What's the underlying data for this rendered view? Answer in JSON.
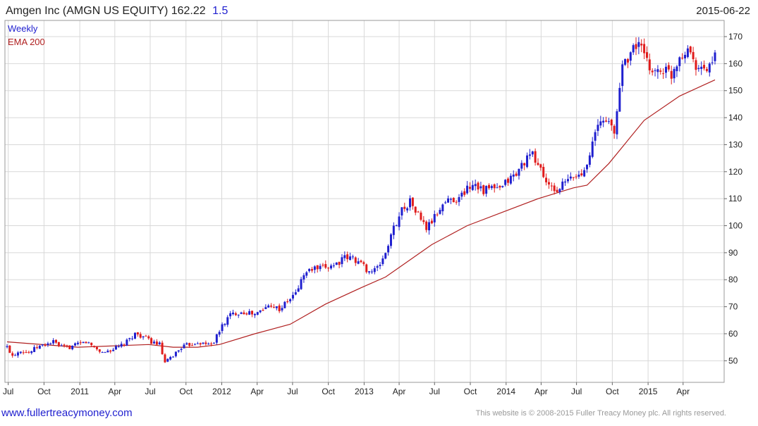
{
  "header": {
    "title": "Amgen Inc (AMGN US EQUITY) 162.22",
    "change": "1.5",
    "date": "2015-06-22"
  },
  "legend": {
    "period": "Weekly",
    "ema_label": "EMA 200"
  },
  "footer": {
    "link": "www.fullertreacymoney.com",
    "copyright": "This website is © 2008-2015 Fuller Treacy Money plc. All rights reserved."
  },
  "colors": {
    "up": "#1f1fcf",
    "down": "#e01b1b",
    "ema": "#b02020",
    "grid": "#d8d8d8",
    "title_change": "#1f1fcf"
  },
  "chart_data": {
    "type": "candlestick",
    "frequency": "weekly",
    "x_range": [
      "2010-06-28",
      "2015-06-22"
    ],
    "ylim": [
      42,
      176
    ],
    "y_ticks": [
      50,
      60,
      70,
      80,
      90,
      100,
      110,
      120,
      130,
      140,
      150,
      160,
      170
    ],
    "x_tick_labels": [
      {
        "date": "2010-07-01",
        "label": "Jul"
      },
      {
        "date": "2010-10-01",
        "label": "Oct"
      },
      {
        "date": "2011-01-01",
        "label": "2011"
      },
      {
        "date": "2011-04-01",
        "label": "Apr"
      },
      {
        "date": "2011-07-01",
        "label": "Jul"
      },
      {
        "date": "2011-10-01",
        "label": "Oct"
      },
      {
        "date": "2012-01-01",
        "label": "2012"
      },
      {
        "date": "2012-04-01",
        "label": "Apr"
      },
      {
        "date": "2012-07-01",
        "label": "Jul"
      },
      {
        "date": "2012-10-01",
        "label": "Oct"
      },
      {
        "date": "2013-01-01",
        "label": "2013"
      },
      {
        "date": "2013-04-01",
        "label": "Apr"
      },
      {
        "date": "2013-07-01",
        "label": "Jul"
      },
      {
        "date": "2013-10-01",
        "label": "Oct"
      },
      {
        "date": "2014-01-01",
        "label": "2014"
      },
      {
        "date": "2014-04-01",
        "label": "Apr"
      },
      {
        "date": "2014-07-01",
        "label": "Jul"
      },
      {
        "date": "2014-10-01",
        "label": "Oct"
      },
      {
        "date": "2015-01-01",
        "label": "2015"
      },
      {
        "date": "2015-04-01",
        "label": "Apr"
      }
    ],
    "close_path": [
      [
        "2010-06-28",
        55
      ],
      [
        "2010-07-12",
        52
      ],
      [
        "2010-08-02",
        54
      ],
      [
        "2010-08-23",
        53
      ],
      [
        "2010-09-13",
        55
      ],
      [
        "2010-10-04",
        56
      ],
      [
        "2010-10-25",
        57
      ],
      [
        "2010-11-15",
        55
      ],
      [
        "2010-12-06",
        55
      ],
      [
        "2010-12-27",
        56
      ],
      [
        "2011-01-17",
        57
      ],
      [
        "2011-02-07",
        55
      ],
      [
        "2011-02-28",
        53
      ],
      [
        "2011-03-21",
        54
      ],
      [
        "2011-04-11",
        55
      ],
      [
        "2011-05-02",
        57
      ],
      [
        "2011-05-23",
        60
      ],
      [
        "2011-06-13",
        59
      ],
      [
        "2011-07-04",
        57
      ],
      [
        "2011-07-25",
        56
      ],
      [
        "2011-08-08",
        49
      ],
      [
        "2011-08-29",
        52
      ],
      [
        "2011-09-19",
        55
      ],
      [
        "2011-10-10",
        56
      ],
      [
        "2011-10-31",
        57
      ],
      [
        "2011-11-21",
        56
      ],
      [
        "2011-12-12",
        57
      ],
      [
        "2012-01-02",
        63
      ],
      [
        "2012-01-23",
        67
      ],
      [
        "2012-02-13",
        68
      ],
      [
        "2012-03-05",
        68
      ],
      [
        "2012-03-26",
        67
      ],
      [
        "2012-04-16",
        69
      ],
      [
        "2012-05-07",
        71
      ],
      [
        "2012-05-28",
        69
      ],
      [
        "2012-06-18",
        72
      ],
      [
        "2012-07-09",
        75
      ],
      [
        "2012-07-30",
        82
      ],
      [
        "2012-08-20",
        84
      ],
      [
        "2012-09-10",
        84
      ],
      [
        "2012-10-01",
        85
      ],
      [
        "2012-10-22",
        86
      ],
      [
        "2012-11-12",
        88
      ],
      [
        "2012-12-03",
        88
      ],
      [
        "2012-12-24",
        86
      ],
      [
        "2013-01-14",
        83
      ],
      [
        "2013-02-04",
        84
      ],
      [
        "2013-02-25",
        90
      ],
      [
        "2013-03-18",
        99
      ],
      [
        "2013-04-08",
        106
      ],
      [
        "2013-04-29",
        109
      ],
      [
        "2013-05-20",
        104
      ],
      [
        "2013-06-10",
        99
      ],
      [
        "2013-07-01",
        103
      ],
      [
        "2013-07-22",
        108
      ],
      [
        "2013-08-12",
        110
      ],
      [
        "2013-09-02",
        110
      ],
      [
        "2013-09-23",
        114
      ],
      [
        "2013-10-14",
        116
      ],
      [
        "2013-11-04",
        113
      ],
      [
        "2013-11-25",
        114
      ],
      [
        "2013-12-16",
        113
      ],
      [
        "2014-01-06",
        117
      ],
      [
        "2014-01-27",
        119
      ],
      [
        "2014-02-17",
        124
      ],
      [
        "2014-03-10",
        126
      ],
      [
        "2014-03-31",
        121
      ],
      [
        "2014-04-21",
        114
      ],
      [
        "2014-05-12",
        113
      ],
      [
        "2014-06-02",
        116
      ],
      [
        "2014-06-23",
        118
      ],
      [
        "2014-07-14",
        119
      ],
      [
        "2014-08-04",
        127
      ],
      [
        "2014-08-25",
        137
      ],
      [
        "2014-09-15",
        140
      ],
      [
        "2014-10-06",
        134
      ],
      [
        "2014-10-27",
        160
      ],
      [
        "2014-11-17",
        164
      ],
      [
        "2014-12-08",
        168
      ],
      [
        "2014-12-29",
        160
      ],
      [
        "2015-01-19",
        157
      ],
      [
        "2015-02-09",
        158
      ],
      [
        "2015-03-02",
        156
      ],
      [
        "2015-03-23",
        163
      ],
      [
        "2015-04-13",
        166
      ],
      [
        "2015-05-04",
        160
      ],
      [
        "2015-05-25",
        157
      ],
      [
        "2015-06-15",
        161
      ],
      [
        "2015-06-22",
        162.22
      ]
    ],
    "ema_200": [
      [
        "2010-06-28",
        57
      ],
      [
        "2010-12-27",
        55
      ],
      [
        "2011-06-27",
        56
      ],
      [
        "2011-08-29",
        55
      ],
      [
        "2011-10-31",
        55
      ],
      [
        "2011-12-26",
        56
      ],
      [
        "2012-03-26",
        60
      ],
      [
        "2012-06-25",
        63.5
      ],
      [
        "2012-09-24",
        71
      ],
      [
        "2012-12-24",
        77
      ],
      [
        "2013-02-25",
        81
      ],
      [
        "2013-06-24",
        93
      ],
      [
        "2013-09-23",
        100
      ],
      [
        "2013-12-23",
        105
      ],
      [
        "2014-03-24",
        110
      ],
      [
        "2014-06-23",
        114
      ],
      [
        "2014-07-28",
        115
      ],
      [
        "2014-09-22",
        123
      ],
      [
        "2014-12-22",
        139
      ],
      [
        "2015-03-23",
        148
      ],
      [
        "2015-06-22",
        154
      ]
    ]
  }
}
